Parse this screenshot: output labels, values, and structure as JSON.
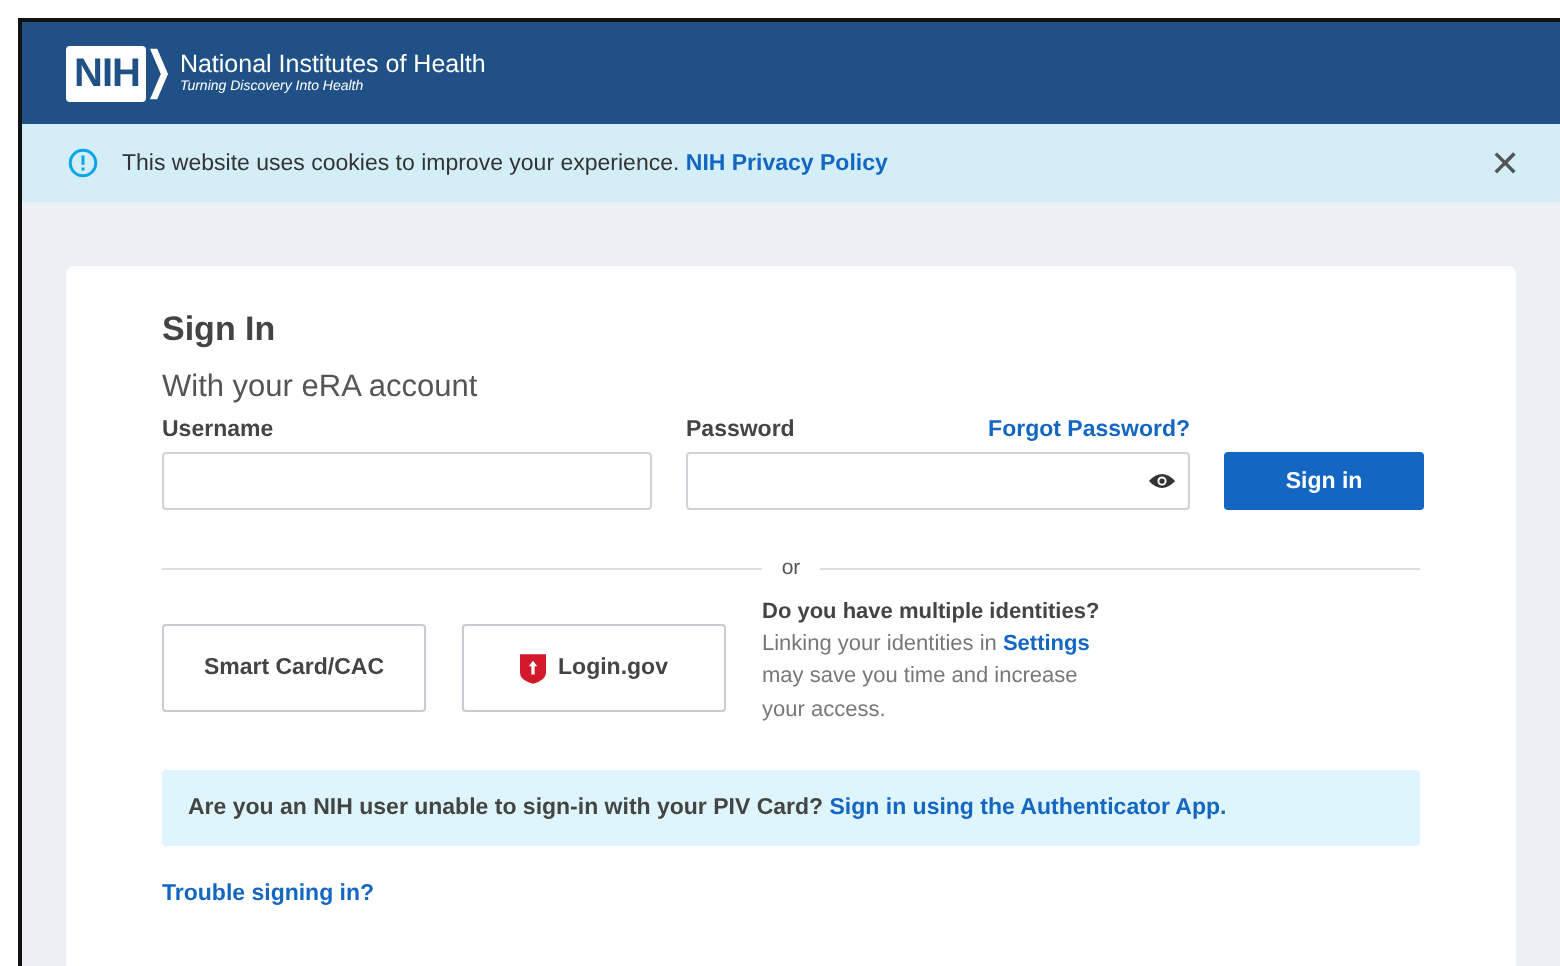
{
  "header": {
    "logo_mark": "NIH",
    "org_name": "National Institutes of Health",
    "tagline": "Turning Discovery Into Health"
  },
  "cookie_banner": {
    "message": "This website uses cookies to improve your experience.",
    "link": "NIH Privacy Policy",
    "close": "✕"
  },
  "sign_in": {
    "title": "Sign In",
    "subtitle": "With your eRA account",
    "username": {
      "label": "Username"
    },
    "password": {
      "label": "Password",
      "forgot_link": "Forgot Password?"
    },
    "submit": "Sign in",
    "divider": "or",
    "alt_buttons": [
      {
        "kind": "plain",
        "label": "Smart Card/CAC"
      },
      {
        "kind": "shield",
        "label": "Login.gov"
      }
    ],
    "identities": {
      "heading": "Do you have multiple identities?",
      "text_before": "Linking your identities in",
      "link": "Settings",
      "text_after": "may save you time and increase your access."
    },
    "piv_notice": {
      "message": "Are you an NIH user unable to sign-in with your PIV Card?",
      "link": "Sign in using the Authenticator App."
    },
    "trouble_link": "Trouble signing in?"
  }
}
